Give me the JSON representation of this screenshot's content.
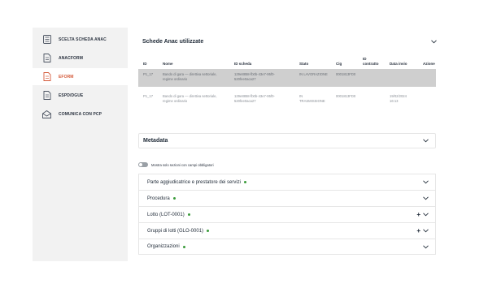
{
  "sidebar": {
    "items": [
      {
        "label": "SCELTA SCHEDA ANAC",
        "icon": "list-icon",
        "active": false
      },
      {
        "label": "ANACFORM",
        "icon": "document-icon",
        "active": false
      },
      {
        "label": "EFORM",
        "icon": "document-icon",
        "active": true
      },
      {
        "label": "ESPD/DGUE",
        "icon": "document-icon",
        "active": false
      },
      {
        "label": "COMUNICA CON PCP",
        "icon": "send-icon",
        "active": false
      }
    ]
  },
  "schede": {
    "title": "Schede Anac utilizzate",
    "columns": [
      "ID",
      "Nome",
      "ID scheda",
      "Stato",
      "Cig",
      "ID contratto",
      "Data invio",
      "Azione"
    ],
    "rows": [
      {
        "id": "P1_17",
        "nome": "Bando di gara — direttiva settoriale, regime ordinario",
        "id_scheda": "129e8858-fb0b-43e7-95f0-520fee0aca27",
        "stato": "IN LAVORAZIONE",
        "cig": "0001813FD0",
        "id_contratto": "",
        "data_invio": ""
      },
      {
        "id": "P1_17",
        "nome": "Bando di gara — direttiva settoriale, regime ordinario",
        "id_scheda": "129e8858-fb0b-43e7-95f0-520fee0aca27",
        "stato": "IN TRASMISSIONE",
        "cig": "0001813FD0",
        "id_contratto": "",
        "data_invio": "19/02/2024 16:13"
      }
    ]
  },
  "metadata": {
    "title": "Metadata"
  },
  "toggle": {
    "label": "Mostra solo sezioni con campi obbligatori"
  },
  "sections": [
    {
      "title": "Parte aggiudicatrice e prestatore dei servizi",
      "addable": false
    },
    {
      "title": "Procedura",
      "addable": false
    },
    {
      "title": "Lotto (LOT-0001)",
      "addable": true
    },
    {
      "title": "Gruppi di lotti (GLO-0001)",
      "addable": true
    },
    {
      "title": "Organizzazioni",
      "addable": false
    }
  ],
  "colors": {
    "active": "#d45a3a",
    "required_dot": "#3a9b3a",
    "sidebar_bg": "#f2f2f2",
    "selected_row": "#cfcfcf"
  }
}
